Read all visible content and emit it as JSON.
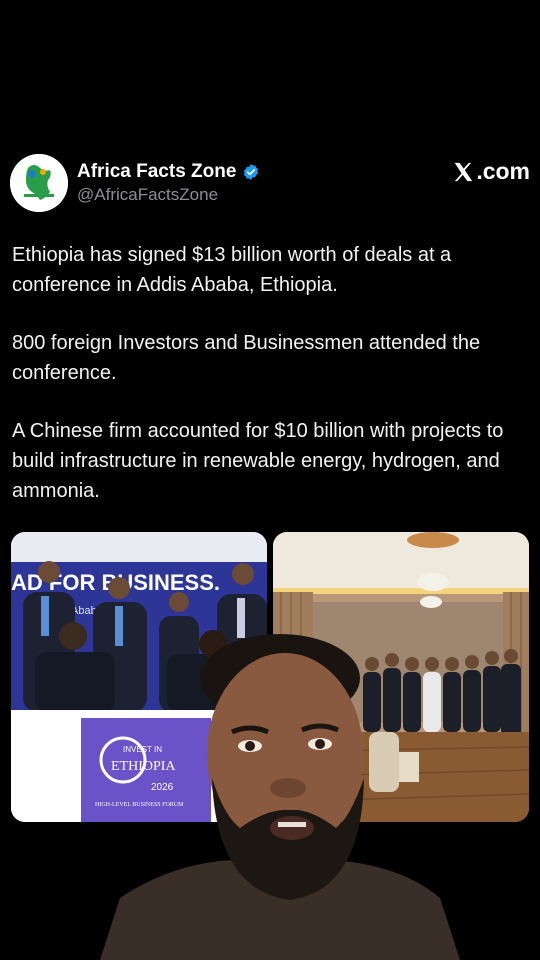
{
  "post": {
    "author_name": "Africa Facts Zone",
    "handle": "@AfricaFactsZone",
    "platform_label": ".com",
    "paragraphs": [
      "Ethiopia has signed $13 billion worth of deals at a conference in Addis Ababa, Ethiopia.",
      "800 foreign Investors and Businessmen attended the conference.",
      "A Chinese firm accounted for $10 billion with projects to build infrastructure in renewable energy, hydrogen, and ammonia."
    ]
  },
  "media": {
    "left_banner_text": "AD  FOR BUSINESS.",
    "left_sign_line1": "INVEST IN",
    "left_sign_line2": "ETHIOPIA",
    "left_sign_year": "2026",
    "left_sign_sub": "HIGH-LEVEL BUSINESS FORUM",
    "left_partial_text": "Abab   thiopia"
  },
  "colors": {
    "background": "#000000",
    "verified_badge": "#1d9bf0",
    "banner_blue": "#2d3596",
    "sign_purple": "#6a53c8"
  },
  "icons": [
    "verified-badge-icon",
    "x-logo-icon"
  ]
}
